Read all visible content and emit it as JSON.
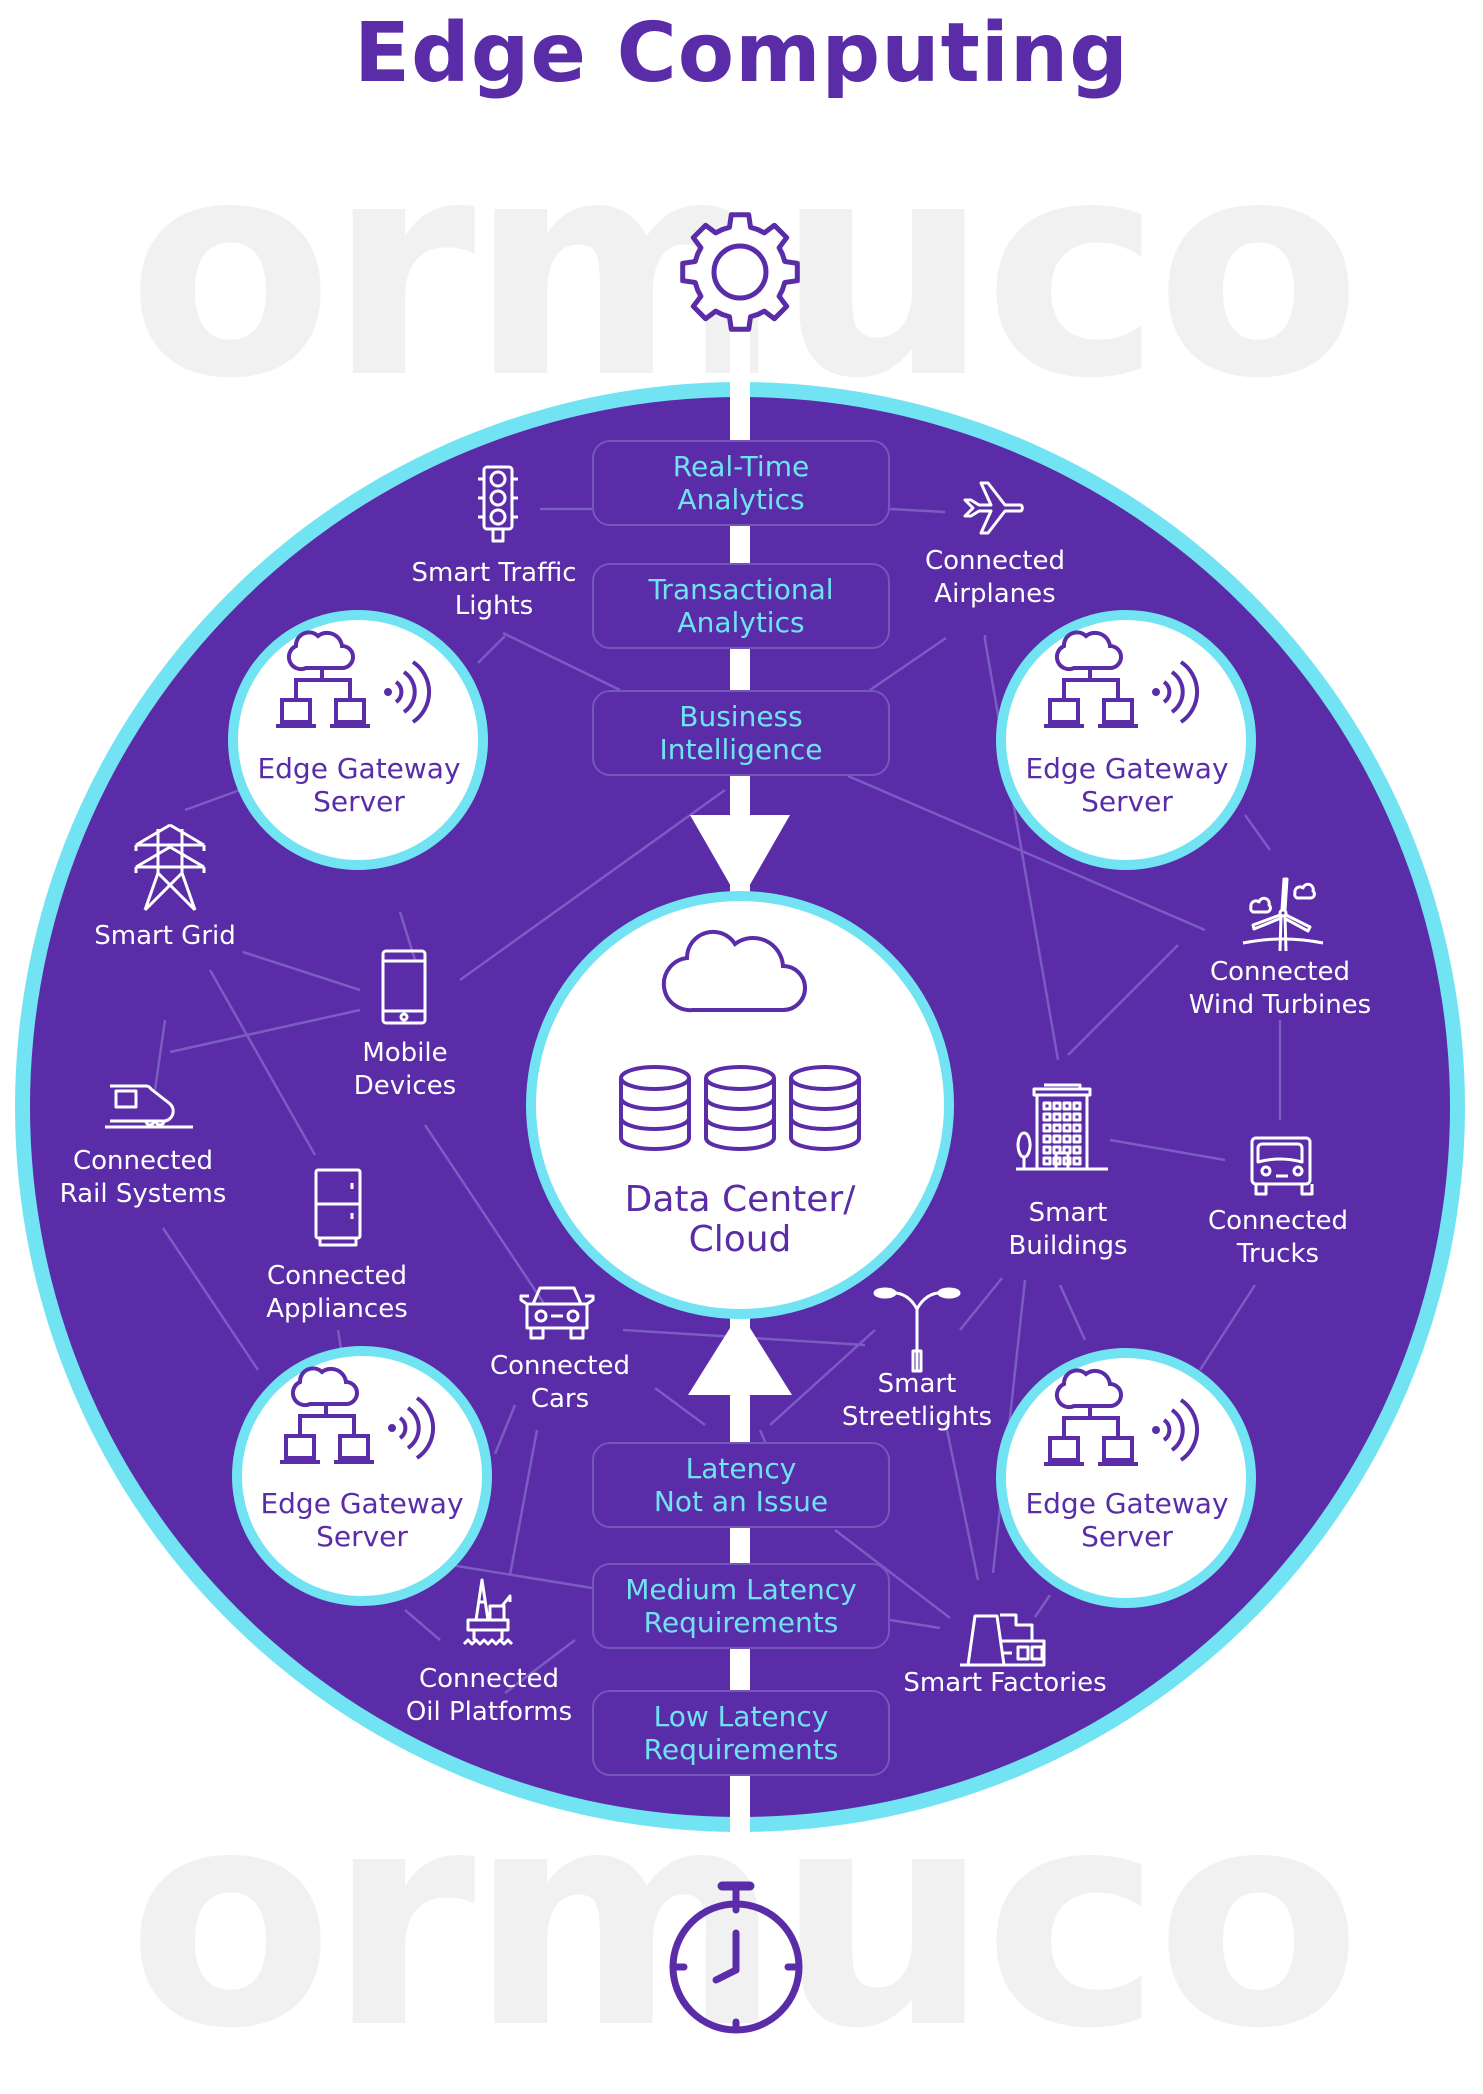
{
  "title": "Edge Computing",
  "watermark": "ormuco",
  "colors": {
    "purple": "#5a2ca8",
    "cyan": "#72e3f2",
    "box_text": "#6fe3f2",
    "line": "#7a5cc2",
    "watermark": "#f1f1f1",
    "white": "#ffffff"
  },
  "top_icon": "gear-icon",
  "bottom_icon": "stopwatch-icon",
  "analytics_boxes": [
    {
      "lines": [
        "Real-Time",
        "Analytics"
      ]
    },
    {
      "lines": [
        "Transactional",
        "Analytics"
      ]
    },
    {
      "lines": [
        "Business",
        "Intelligence"
      ]
    }
  ],
  "latency_boxes": [
    {
      "lines": [
        "Latency",
        "Not an Issue"
      ]
    },
    {
      "lines": [
        "Medium Latency",
        "Requirements"
      ]
    },
    {
      "lines": [
        "Low Latency",
        "Requirements"
      ]
    }
  ],
  "center": {
    "icon": "cloud-database-icon",
    "lines": [
      "Data Center/",
      "Cloud"
    ]
  },
  "gateways": [
    {
      "lines": [
        "Edge Gateway",
        "Server"
      ]
    },
    {
      "lines": [
        "Edge Gateway",
        "Server"
      ]
    },
    {
      "lines": [
        "Edge Gateway",
        "Server"
      ]
    },
    {
      "lines": [
        "Edge Gateway",
        "Server"
      ]
    }
  ],
  "nodes": [
    {
      "icon": "traffic-light-icon",
      "lines": [
        "Smart Traffic",
        "Lights"
      ]
    },
    {
      "icon": "airplane-icon",
      "lines": [
        "Connected",
        "Airplanes"
      ]
    },
    {
      "icon": "power-tower-icon",
      "lines": [
        "Smart Grid"
      ]
    },
    {
      "icon": "mobile-phone-icon",
      "lines": [
        "Mobile",
        "Devices"
      ]
    },
    {
      "icon": "train-icon",
      "lines": [
        "Connected",
        "Rail Systems"
      ]
    },
    {
      "icon": "refrigerator-icon",
      "lines": [
        "Connected",
        "Appliances"
      ]
    },
    {
      "icon": "car-icon",
      "lines": [
        "Connected",
        "Cars"
      ]
    },
    {
      "icon": "oil-platform-icon",
      "lines": [
        "Connected",
        "Oil Platforms"
      ]
    },
    {
      "icon": "wind-turbine-icon",
      "lines": [
        "Connected",
        "Wind Turbines"
      ]
    },
    {
      "icon": "building-icon",
      "lines": [
        "Smart",
        "Buildings"
      ]
    },
    {
      "icon": "truck-icon",
      "lines": [
        "Connected",
        "Trucks"
      ]
    },
    {
      "icon": "streetlight-icon",
      "lines": [
        "Smart",
        "Streetlights"
      ]
    },
    {
      "icon": "factory-icon",
      "lines": [
        "Smart Factories"
      ]
    }
  ]
}
